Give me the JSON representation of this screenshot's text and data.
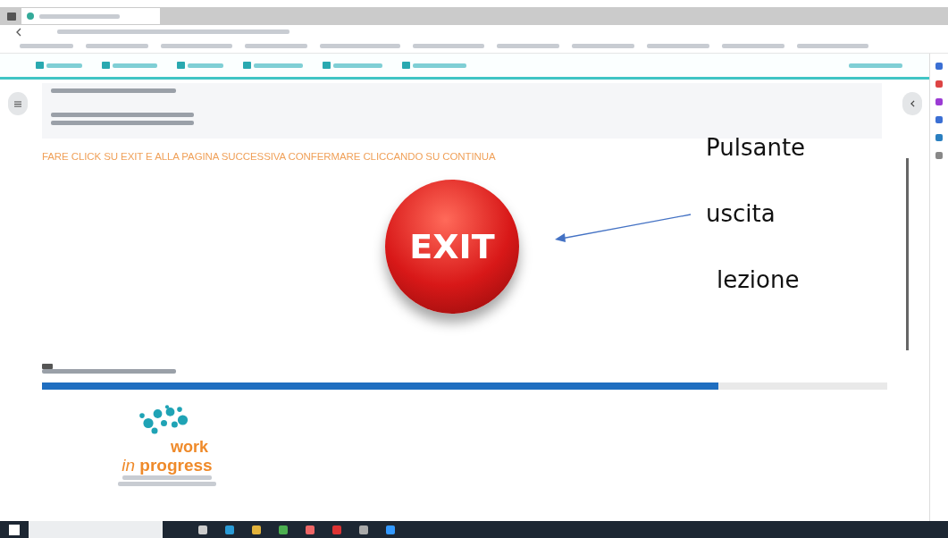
{
  "instruction": "FARE CLICK SU EXIT E ALLA PAGINA SUCCESSIVA CONFERMARE CLICCANDO SU CONTINUA",
  "exit_button": {
    "label": "EXIT"
  },
  "annotation": {
    "lines": [
      "Pulsante",
      "uscita",
      "lezione"
    ]
  },
  "progress": {
    "level": 0.8
  },
  "logo": {
    "line_1": "work",
    "line_2_italic": "in",
    "line_2": "progress"
  }
}
